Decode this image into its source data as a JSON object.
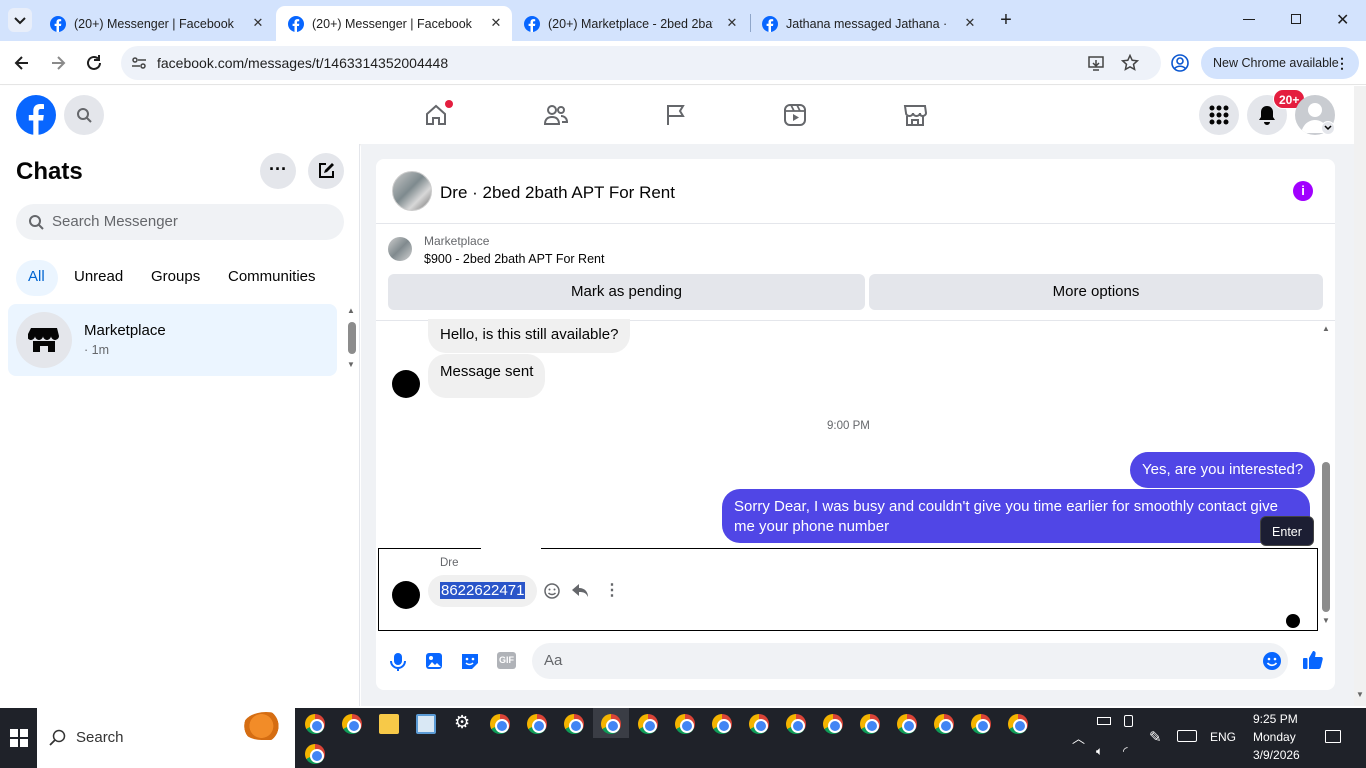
{
  "browser": {
    "tabs": [
      {
        "title": "(20+) Messenger | Facebook",
        "active": false
      },
      {
        "title": "(20+) Messenger | Facebook",
        "active": true
      },
      {
        "title": "(20+) Marketplace - 2bed 2bath",
        "active": false
      },
      {
        "title": "Jathana messaged Jathana · 2bed",
        "active": false
      }
    ],
    "url": "facebook.com/messages/t/1463314352004448",
    "new_chrome_label": "New Chrome available"
  },
  "fb_header": {
    "notification_badge": "20+"
  },
  "left_panel": {
    "title": "Chats",
    "search_placeholder": "Search Messenger",
    "filters": [
      "All",
      "Unread",
      "Groups",
      "Communities"
    ],
    "active_filter": "All",
    "chats": [
      {
        "name": "Marketplace",
        "meta": "· 1m"
      }
    ]
  },
  "conversation": {
    "title": "Dre · 2bed 2bath APT For Rent",
    "listing_source": "Marketplace",
    "listing_title": "$900 - 2bed 2bath APT For Rent",
    "mark_pending_label": "Mark as pending",
    "more_options_label": "More options",
    "messages": [
      {
        "direction": "in",
        "text": "Hello, is this still available?"
      },
      {
        "direction": "in",
        "text": "Message sent"
      },
      {
        "direction": "timestamp",
        "text": "9:00 PM"
      },
      {
        "direction": "out",
        "text": "Yes, are you interested?"
      },
      {
        "direction": "out",
        "text": "Sorry Dear, I was busy and couldn't give you time earlier for smoothly contact give me your phone number"
      },
      {
        "direction": "in",
        "sender": "Dre",
        "text": "8622622471"
      }
    ],
    "tooltip": "Enter",
    "composer_placeholder": "Aa"
  },
  "taskbar": {
    "search_label": "Search",
    "language": "ENG",
    "time": "9:25 PM",
    "day": "Monday",
    "date": "3/9/2026"
  },
  "colors": {
    "fb_blue": "#0866ff",
    "outgoing_bubble": "#5046e6",
    "badge_red": "#e41e3f",
    "info_purple": "#a100ff"
  }
}
